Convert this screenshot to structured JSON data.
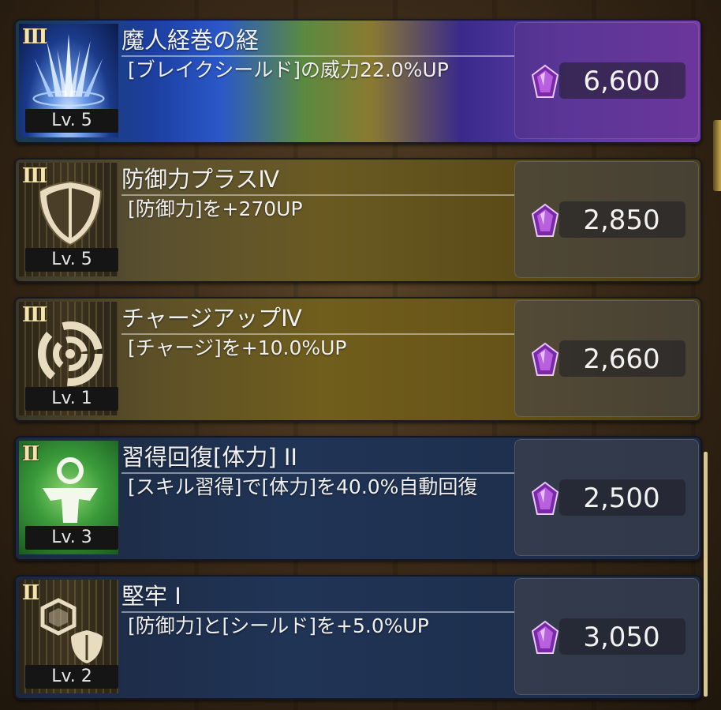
{
  "skills": [
    {
      "rank": "III",
      "level": "Lv. 5",
      "title": "魔人経巻の経",
      "description": "[ブレイクシールド]の威力22.0%UP",
      "cost": "6,600",
      "icon": "crystal-spikes-icon"
    },
    {
      "rank": "III",
      "level": "Lv. 5",
      "title": "防御力プラスⅣ",
      "description": "[防御力]を+270UP",
      "cost": "2,850",
      "icon": "shield-icon"
    },
    {
      "rank": "III",
      "level": "Lv. 1",
      "title": "チャージアップⅣ",
      "description": "[チャージ]を+10.0%UP",
      "cost": "2,660",
      "icon": "swirl-icon"
    },
    {
      "rank": "II",
      "level": "Lv. 3",
      "title": "習得回復[体力] II",
      "description": "[スキル習得]で[体力]を40.0%自動回復",
      "cost": "2,500",
      "icon": "figure-heal-icon"
    },
    {
      "rank": "II",
      "level": "Lv. 2",
      "title": "堅牢 I",
      "description": "[防御力]と[シールド]を+5.0%UP",
      "cost": "3,050",
      "icon": "hexagon-shield-icon"
    }
  ],
  "currency_icon": "purple-gem-icon",
  "colors": {
    "gem": "#9a3ac8",
    "text": "#f1f1f1"
  }
}
